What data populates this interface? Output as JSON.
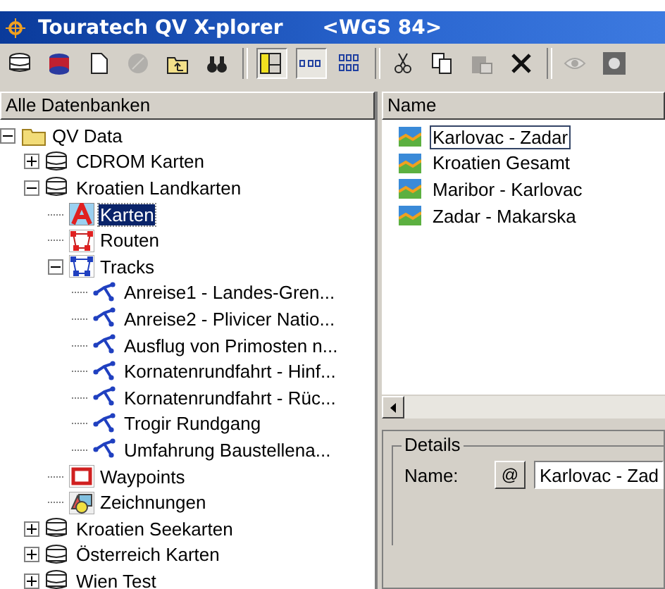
{
  "window": {
    "title": "Touratech QV X-plorer",
    "subtitle": "<WGS 84>"
  },
  "toolbar": [
    {
      "kind": "database",
      "disabled": false
    },
    {
      "kind": "database-red",
      "disabled": false
    },
    {
      "kind": "page",
      "disabled": false
    },
    {
      "kind": "disc",
      "disabled": true
    },
    {
      "kind": "folder-up",
      "disabled": false
    },
    {
      "kind": "binoculars",
      "disabled": false
    },
    {
      "kind": "separator"
    },
    {
      "kind": "layout",
      "selected": true
    },
    {
      "kind": "list-view",
      "selected": true
    },
    {
      "kind": "detail-view",
      "selected": false
    },
    {
      "kind": "separator"
    },
    {
      "kind": "scissors",
      "disabled": false
    },
    {
      "kind": "copy",
      "disabled": false
    },
    {
      "kind": "paste",
      "disabled": true
    },
    {
      "kind": "delete",
      "disabled": false
    },
    {
      "kind": "separator"
    },
    {
      "kind": "eye",
      "disabled": true
    },
    {
      "kind": "eye-box",
      "disabled": false
    }
  ],
  "tree": {
    "header": "Alle Datenbanken",
    "items": [
      {
        "label": "QV Data",
        "kind": "folder",
        "expanded": true,
        "selected": false,
        "children": [
          {
            "label": "CDROM Karten",
            "kind": "database",
            "expanded": false,
            "selected": false
          },
          {
            "label": "Kroatien Landkarten",
            "kind": "database",
            "expanded": true,
            "selected": false,
            "children": [
              {
                "label": "Karten",
                "kind": "maps",
                "selected": true
              },
              {
                "label": "Routen",
                "kind": "routes",
                "selected": false
              },
              {
                "label": "Tracks",
                "kind": "tracks",
                "expanded": true,
                "selected": false,
                "children": [
                  {
                    "label": "Anreise1 - Landes-Gren...",
                    "kind": "track",
                    "selected": false
                  },
                  {
                    "label": "Anreise2 - Plivicer Natio...",
                    "kind": "track",
                    "selected": false
                  },
                  {
                    "label": "Ausflug von Primosten n...",
                    "kind": "track",
                    "selected": false
                  },
                  {
                    "label": "Kornatenrundfahrt - Hinf...",
                    "kind": "track",
                    "selected": false
                  },
                  {
                    "label": "Kornatenrundfahrt - Rüc...",
                    "kind": "track",
                    "selected": false
                  },
                  {
                    "label": "Trogir Rundgang",
                    "kind": "track",
                    "selected": false
                  },
                  {
                    "label": "Umfahrung Baustellena...",
                    "kind": "track",
                    "selected": false
                  }
                ]
              },
              {
                "label": "Waypoints",
                "kind": "waypoints",
                "selected": false
              },
              {
                "label": "Zeichnungen",
                "kind": "drawings",
                "selected": false
              }
            ]
          },
          {
            "label": "Kroatien Seekarten",
            "kind": "database",
            "expanded": false,
            "selected": false
          },
          {
            "label": "Österreich Karten",
            "kind": "database",
            "expanded": false,
            "selected": false
          },
          {
            "label": "Wien Test",
            "kind": "database",
            "expanded": false,
            "selected": false
          }
        ]
      }
    ]
  },
  "list": {
    "header": "Name",
    "items": [
      {
        "label": "Karlovac - Zadar",
        "selected": true
      },
      {
        "label": "Kroatien Gesamt",
        "selected": false
      },
      {
        "label": "Maribor - Karlovac",
        "selected": false
      },
      {
        "label": "Zadar - Makarska",
        "selected": false
      }
    ]
  },
  "details": {
    "legend": "Details",
    "name_label": "Name:",
    "name_button": "@",
    "name_value": "Karlovac - Zad"
  }
}
